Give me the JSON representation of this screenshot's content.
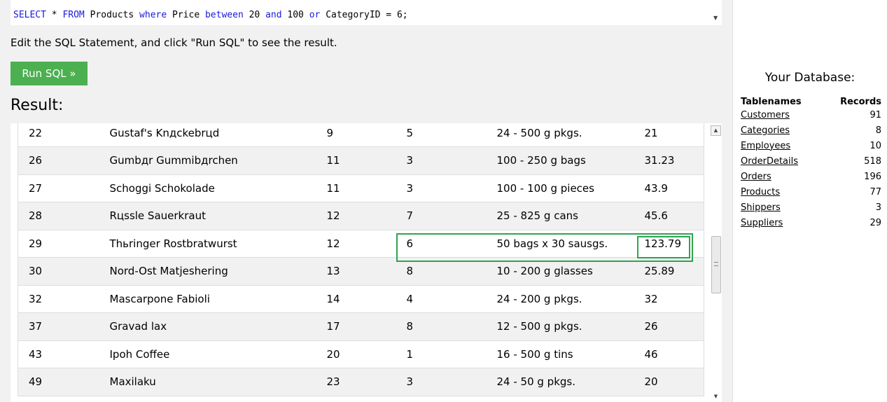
{
  "editor": {
    "sql_tokens": [
      {
        "text": "SELECT",
        "kw": true
      },
      {
        "text": " * ",
        "kw": false
      },
      {
        "text": "FROM",
        "kw": true
      },
      {
        "text": " Products ",
        "kw": false
      },
      {
        "text": "where",
        "kw": true
      },
      {
        "text": " Price ",
        "kw": false
      },
      {
        "text": "between",
        "kw": true
      },
      {
        "text": " 20 ",
        "kw": false
      },
      {
        "text": "and",
        "kw": true
      },
      {
        "text": " 100 ",
        "kw": false
      },
      {
        "text": "or",
        "kw": true
      },
      {
        "text": " CategoryID = 6;",
        "kw": false
      }
    ],
    "scroll_arrow": "▼"
  },
  "instruction": "Edit the SQL Statement, and click \"Run SQL\" to see the result.",
  "run_button_label": "Run SQL »",
  "result_heading": "Result:",
  "results": {
    "rows": [
      [
        "22",
        "Gustaf's Knдckebrцd",
        "9",
        "5",
        "24 - 500 g pkgs.",
        "21"
      ],
      [
        "26",
        "Gumbдr Gummibдrchen",
        "11",
        "3",
        "100 - 250 g bags",
        "31.23"
      ],
      [
        "27",
        "Schoggi Schokolade",
        "11",
        "3",
        "100 - 100 g pieces",
        "43.9"
      ],
      [
        "28",
        "Rцssle Sauerkraut",
        "12",
        "7",
        "25 - 825 g cans",
        "45.6"
      ],
      [
        "29",
        "Thьringer Rostbratwurst",
        "12",
        "6",
        "50 bags x 30 sausgs.",
        "123.79"
      ],
      [
        "30",
        "Nord-Ost Matjeshering",
        "13",
        "8",
        "10 - 200 g glasses",
        "25.89"
      ],
      [
        "32",
        "Mascarpone Fabioli",
        "14",
        "4",
        "24 - 200 g pkgs.",
        "32"
      ],
      [
        "37",
        "Gravad lax",
        "17",
        "8",
        "12 - 500 g pkgs.",
        "26"
      ],
      [
        "43",
        "Ipoh Coffee",
        "20",
        "1",
        "16 - 500 g tins",
        "46"
      ],
      [
        "49",
        "Maxilaku",
        "23",
        "3",
        "24 - 50 g pkgs.",
        "20"
      ]
    ],
    "highlight_color": "#2ea44f"
  },
  "sidebar": {
    "title": "Your Database:",
    "col_tablenames": "Tablenames",
    "col_records": "Records",
    "tables": [
      {
        "name": "Customers",
        "records": "91"
      },
      {
        "name": "Categories",
        "records": "8"
      },
      {
        "name": "Employees",
        "records": "10"
      },
      {
        "name": "OrderDetails",
        "records": "518"
      },
      {
        "name": "Orders",
        "records": "196"
      },
      {
        "name": "Products",
        "records": "77"
      },
      {
        "name": "Shippers",
        "records": "3"
      },
      {
        "name": "Suppliers",
        "records": "29"
      }
    ]
  },
  "colors": {
    "run_button": "#4caf50",
    "keyword": "#1a1adb"
  }
}
